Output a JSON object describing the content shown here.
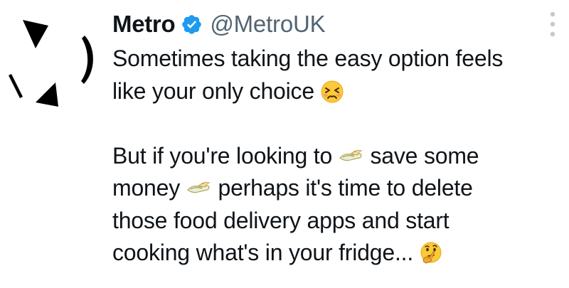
{
  "tweet": {
    "author": {
      "display_name": "Metro",
      "handle": "@MetroUK",
      "verified": true,
      "verified_color": "#1d9bf0"
    },
    "more_icon": "vertical-ellipsis-icon",
    "lines": {
      "p1_l1": "Sometimes taking the easy option feels",
      "p1_l2": "like your only choice",
      "p2_l1_a": "But if you're looking to",
      "p2_l1_b": "save some",
      "p2_l2_a": "money",
      "p2_l2_b": "perhaps it's time to delete",
      "p2_l3": "those food delivery apps and start",
      "p2_l4": "cooking what's in your fridge..."
    },
    "emojis": [
      "persevering-face-emoji",
      "money-with-wings-emoji",
      "money-with-wings-emoji",
      "thinking-face-emoji"
    ],
    "colors": {
      "text": "#0f1419",
      "secondary_text": "#536471",
      "background": "#ffffff"
    }
  }
}
